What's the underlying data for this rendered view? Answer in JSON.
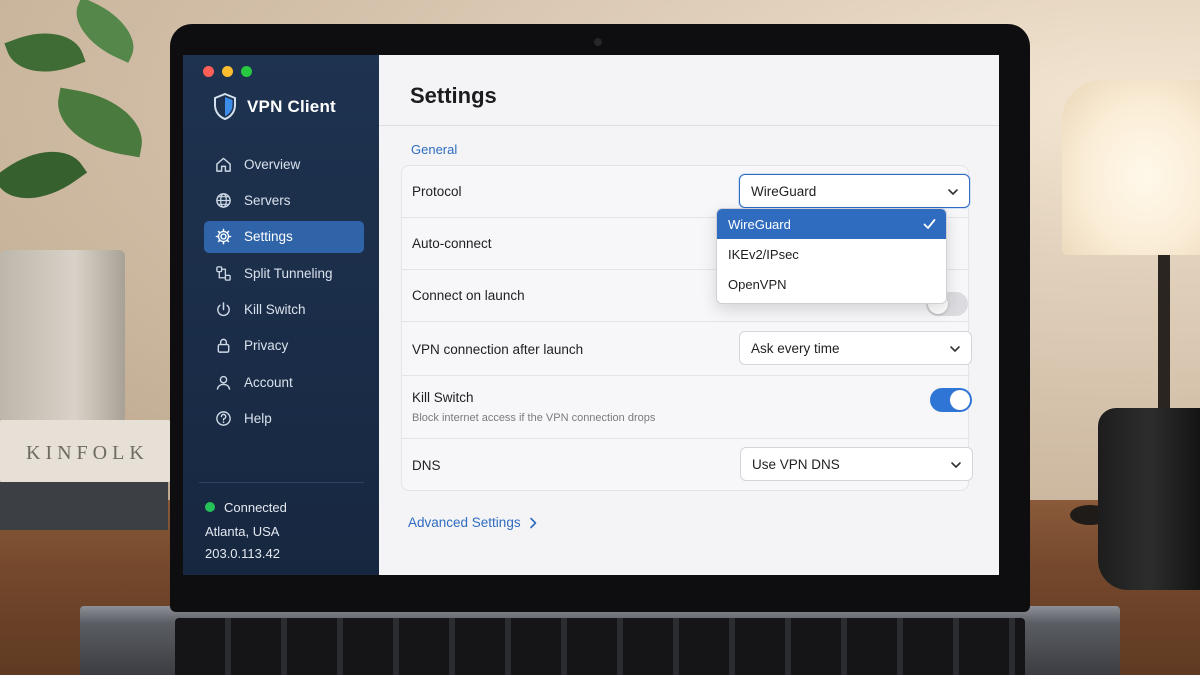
{
  "window": {
    "traffic_lights": {
      "close": "#ff5f57",
      "minimize": "#febc2e",
      "zoom": "#28c840"
    }
  },
  "sidebar": {
    "app_title": "VPN Client",
    "logo_icon": "shield-icon",
    "items": [
      {
        "label": "Overview",
        "icon": "home-icon",
        "active": false
      },
      {
        "label": "Servers",
        "icon": "globe-icon",
        "active": false
      },
      {
        "label": "Settings",
        "icon": "gear-icon",
        "active": true
      },
      {
        "label": "Split Tunneling",
        "icon": "split-icon",
        "active": false
      },
      {
        "label": "Kill Switch",
        "icon": "kill-switch-icon",
        "active": false
      },
      {
        "label": "Privacy",
        "icon": "lock-icon",
        "active": false
      },
      {
        "label": "Account",
        "icon": "user-icon",
        "active": false
      },
      {
        "label": "Help",
        "icon": "help-icon",
        "active": false
      }
    ],
    "status": {
      "state": "Connected",
      "location": "Atlanta, USA",
      "ip": "203.0.113.42",
      "indicator_color": "#27c15a"
    }
  },
  "main": {
    "title": "Settings",
    "section": "General",
    "rows": [
      {
        "label": "Protocol",
        "control": "select",
        "value": "WireGuard"
      },
      {
        "label": "Auto-connect",
        "control": "toggle"
      },
      {
        "label": "Connect on launch",
        "control": "toggle",
        "on": false
      },
      {
        "label": "VPN connection after launch",
        "control": "select",
        "value": "Ask every time"
      },
      {
        "label": "Kill Switch",
        "sublabel": "Block internet access if the VPN connection drops",
        "control": "toggle",
        "on": true
      },
      {
        "label": "DNS",
        "control": "select",
        "value": "Use VPN DNS"
      }
    ],
    "protocol_dropdown": {
      "options": [
        "WireGuard",
        "IKEv2/IPsec",
        "OpenVPN"
      ],
      "selected": "WireGuard"
    },
    "advanced_link": "Advanced Settings"
  },
  "colors": {
    "accent": "#2f6cc0",
    "sidebar_bg": "#1e3350",
    "sidebar_active": "#2f64a8",
    "toggle_on": "#2f75d6"
  }
}
